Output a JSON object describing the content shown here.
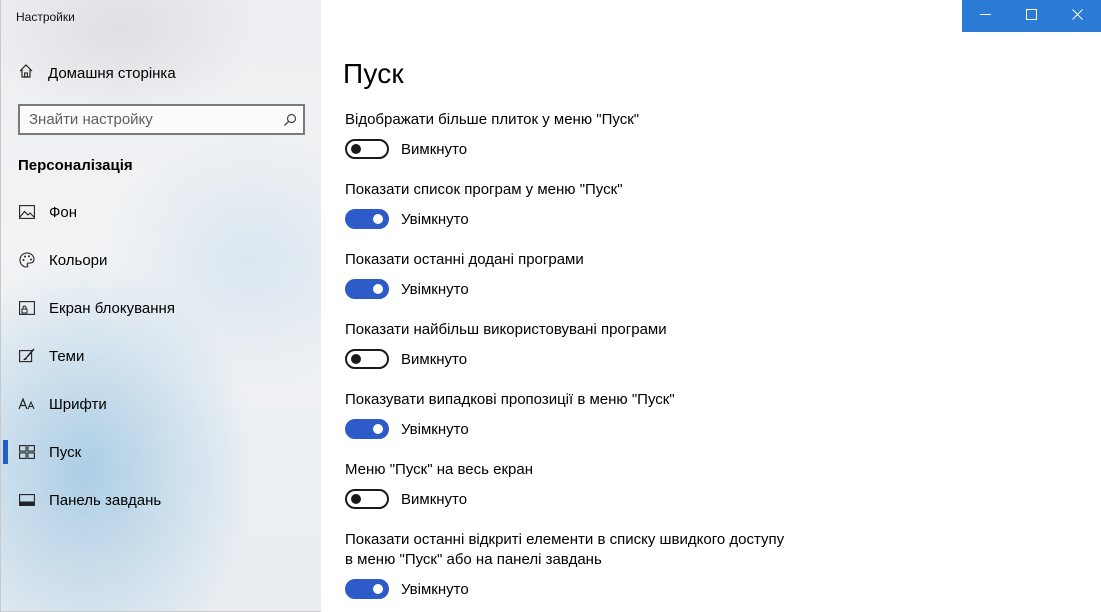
{
  "window": {
    "title": "Настройки",
    "controls": [
      "minimize-icon",
      "maximize-icon",
      "close-icon"
    ]
  },
  "sidebar": {
    "home_label": "Домашня сторінка",
    "search_placeholder": "Знайти настройку",
    "section_title": "Персоналізація",
    "items": [
      {
        "label": "Фон",
        "icon": "picture-icon",
        "selected": false
      },
      {
        "label": "Кольори",
        "icon": "palette-icon",
        "selected": false
      },
      {
        "label": "Екран блокування",
        "icon": "lock-screen-icon",
        "selected": false
      },
      {
        "label": "Теми",
        "icon": "brush-icon",
        "selected": false
      },
      {
        "label": "Шрифти",
        "icon": "fonts-icon",
        "selected": false
      },
      {
        "label": "Пуск",
        "icon": "start-icon",
        "selected": true
      },
      {
        "label": "Панель завдань",
        "icon": "taskbar-icon",
        "selected": false
      }
    ]
  },
  "content": {
    "title": "Пуск",
    "settings": [
      {
        "description": "Відображати більше плиток у меню \"Пуск\"",
        "state": "Вимкнуто",
        "on": false
      },
      {
        "description": "Показати список програм у меню \"Пуск\"",
        "state": "Увімкнуто",
        "on": true
      },
      {
        "description": "Показати останні додані програми",
        "state": "Увімкнуто",
        "on": true
      },
      {
        "description": "Показати найбільш використовувані програми",
        "state": "Вимкнуто",
        "on": false
      },
      {
        "description": "Показувати випадкові пропозиції в меню \"Пуск\"",
        "state": "Увімкнуто",
        "on": true
      },
      {
        "description": "Меню \"Пуск\" на весь екран",
        "state": "Вимкнуто",
        "on": false
      },
      {
        "description": "Показати останні відкриті елементи в списку швидкого доступу в меню \"Пуск\" або на панелі завдань",
        "state": "Увімкнуто",
        "on": true
      }
    ]
  },
  "colors": {
    "accent": "#2d5cc8",
    "titlebar": "#2b7bd6",
    "selection_bar": "#1f5dc9"
  }
}
